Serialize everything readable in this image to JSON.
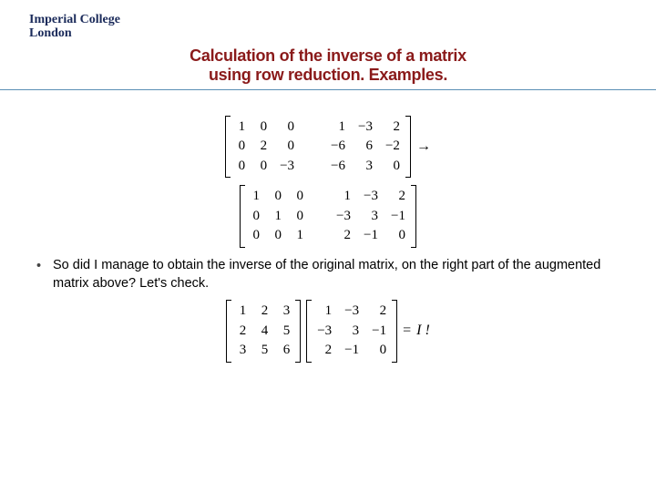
{
  "logo": {
    "line1": "Imperial College",
    "line2": "London"
  },
  "title": {
    "line1": "Calculation of the inverse of a matrix",
    "line2": "using row reduction. Examples."
  },
  "m1": {
    "c1": [
      "1",
      "0",
      "0"
    ],
    "c2": [
      "0",
      "2",
      "0"
    ],
    "c3": [
      "0",
      "0",
      "−3"
    ],
    "c4": [
      "1",
      "−6",
      "−6"
    ],
    "c5": [
      "−3",
      "6",
      "3"
    ],
    "c6": [
      "2",
      "−2",
      "0"
    ],
    "arrow": "→"
  },
  "m2": {
    "c1": [
      "1",
      "0",
      "0"
    ],
    "c2": [
      "0",
      "1",
      "0"
    ],
    "c3": [
      "0",
      "0",
      "1"
    ],
    "c4": [
      "1",
      "−3",
      "2"
    ],
    "c5": [
      "−3",
      "3",
      "−1"
    ],
    "c6": [
      "2",
      "−1",
      "0"
    ]
  },
  "bullet": "So did I manage to obtain the inverse of the original matrix, on the right part of the augmented matrix above? Let's check.",
  "m3": {
    "A": {
      "c1": [
        "1",
        "2",
        "3"
      ],
      "c2": [
        "2",
        "4",
        "5"
      ],
      "c3": [
        "3",
        "5",
        "6"
      ]
    },
    "B": {
      "c1": [
        "1",
        "−3",
        "2"
      ],
      "c2": [
        "−3",
        "3",
        "−1"
      ],
      "c3": [
        "2",
        "−1",
        "0"
      ]
    },
    "eq": "=",
    "rhs": "I !"
  }
}
